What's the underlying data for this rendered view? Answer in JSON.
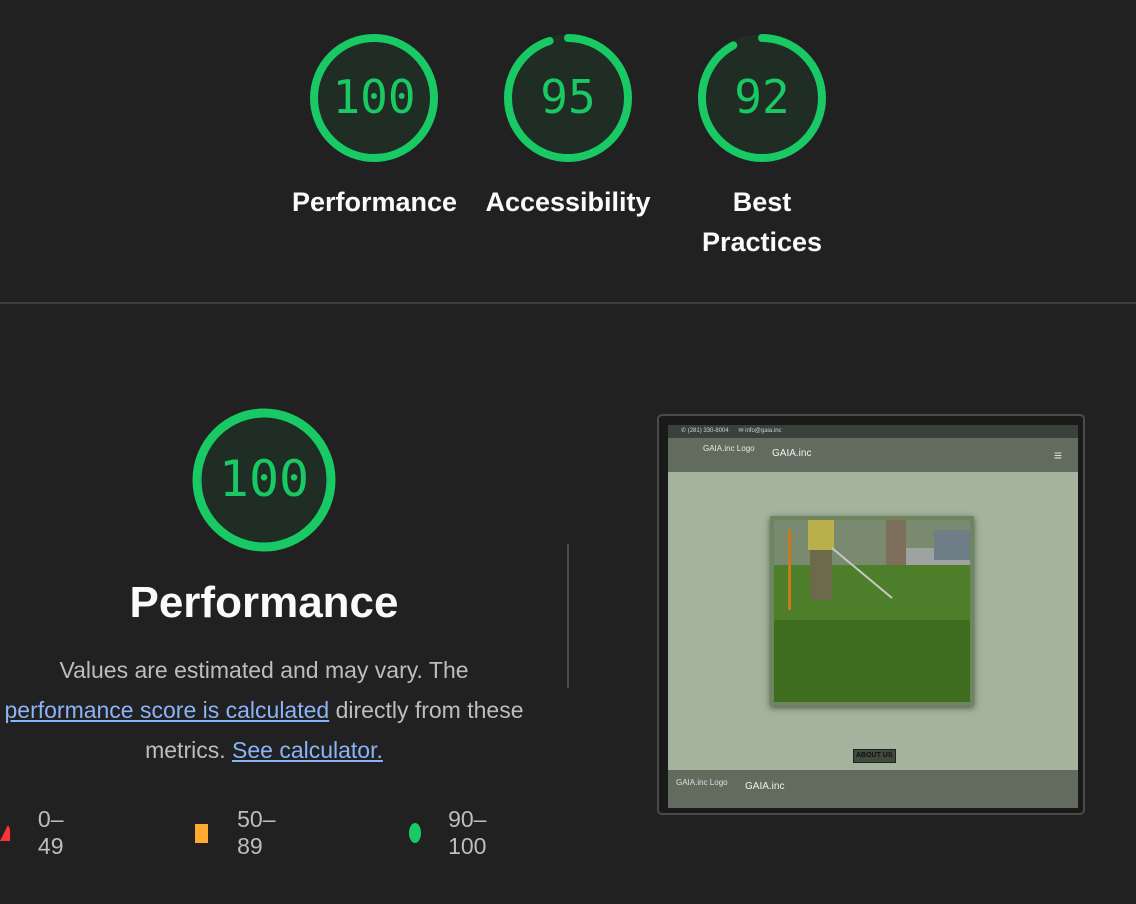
{
  "scores": [
    {
      "value": "100",
      "label": "Performance",
      "fraction": 1.0
    },
    {
      "value": "95",
      "label": "Accessibility",
      "fraction": 0.95
    },
    {
      "value": "92",
      "label_line1": "Best",
      "label_line2": "Practices",
      "fraction": 0.92
    }
  ],
  "main": {
    "score": "100",
    "fraction": 1.0,
    "title": "Performance",
    "desc_pre": "Values are estimated and may vary. The",
    "desc_link": "performance score is calculated",
    "desc_mid": " directly from these metrics. ",
    "desc_link2": "See calculator."
  },
  "legend": [
    {
      "range": "0–49",
      "color": "#ff3333",
      "shape": "triangle"
    },
    {
      "range": "50–89",
      "color": "#ffaa33",
      "shape": "square"
    },
    {
      "range": "90–100",
      "color": "#18c964",
      "shape": "circle"
    }
  ],
  "colors": {
    "good": "#18c964",
    "good_fill": "#1f2d24"
  },
  "screenshot": {
    "phone": "(281) 330-8004",
    "email": "info@gaia.inc",
    "logo_alt": "GAIA.inc Logo",
    "brand": "GAIA.inc",
    "button": "ABOUT US",
    "footer_logo_alt": "GAIA.inc Logo",
    "footer_brand": "GAIA.inc"
  }
}
